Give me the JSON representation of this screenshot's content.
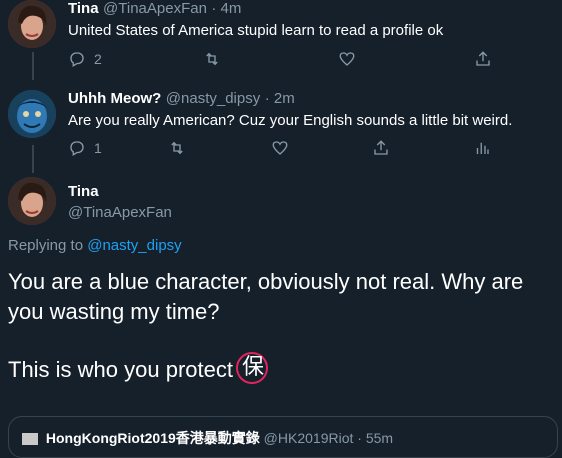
{
  "tweet1": {
    "name": "Tina",
    "handle": "@TinaApexFan",
    "time": "· 4m",
    "text": "United States of America stupid learn to read a profile ok",
    "reply_count": "2"
  },
  "tweet2": {
    "name": "Uhhh Meow?",
    "handle": "@nasty_dipsy",
    "time": "· 2m",
    "text": "Are you really American? Cuz your English sounds a little bit weird.",
    "reply_count": "1"
  },
  "main_tweet": {
    "name": "Tina",
    "handle": "@TinaApexFan",
    "replying_to_prefix": "Replying to",
    "replying_to_handle": "@nasty_dipsy",
    "text_line1": "You are a blue character, obviously not real. Why are",
    "text_line2": "you wasting my time?",
    "text_line3": "This is who you protect",
    "glyph": "保"
  },
  "quoted": {
    "name": "HongKongRiot2019香港暴動實錄",
    "handle": "@HK2019Riot",
    "time": "· 55m"
  },
  "colors": {
    "background": "#15202b",
    "muted": "#8899a6",
    "link": "#1da1f2",
    "circle": "#e0245e"
  },
  "icons": [
    "reply-icon",
    "retweet-icon",
    "like-icon",
    "share-icon",
    "analytics-icon"
  ]
}
